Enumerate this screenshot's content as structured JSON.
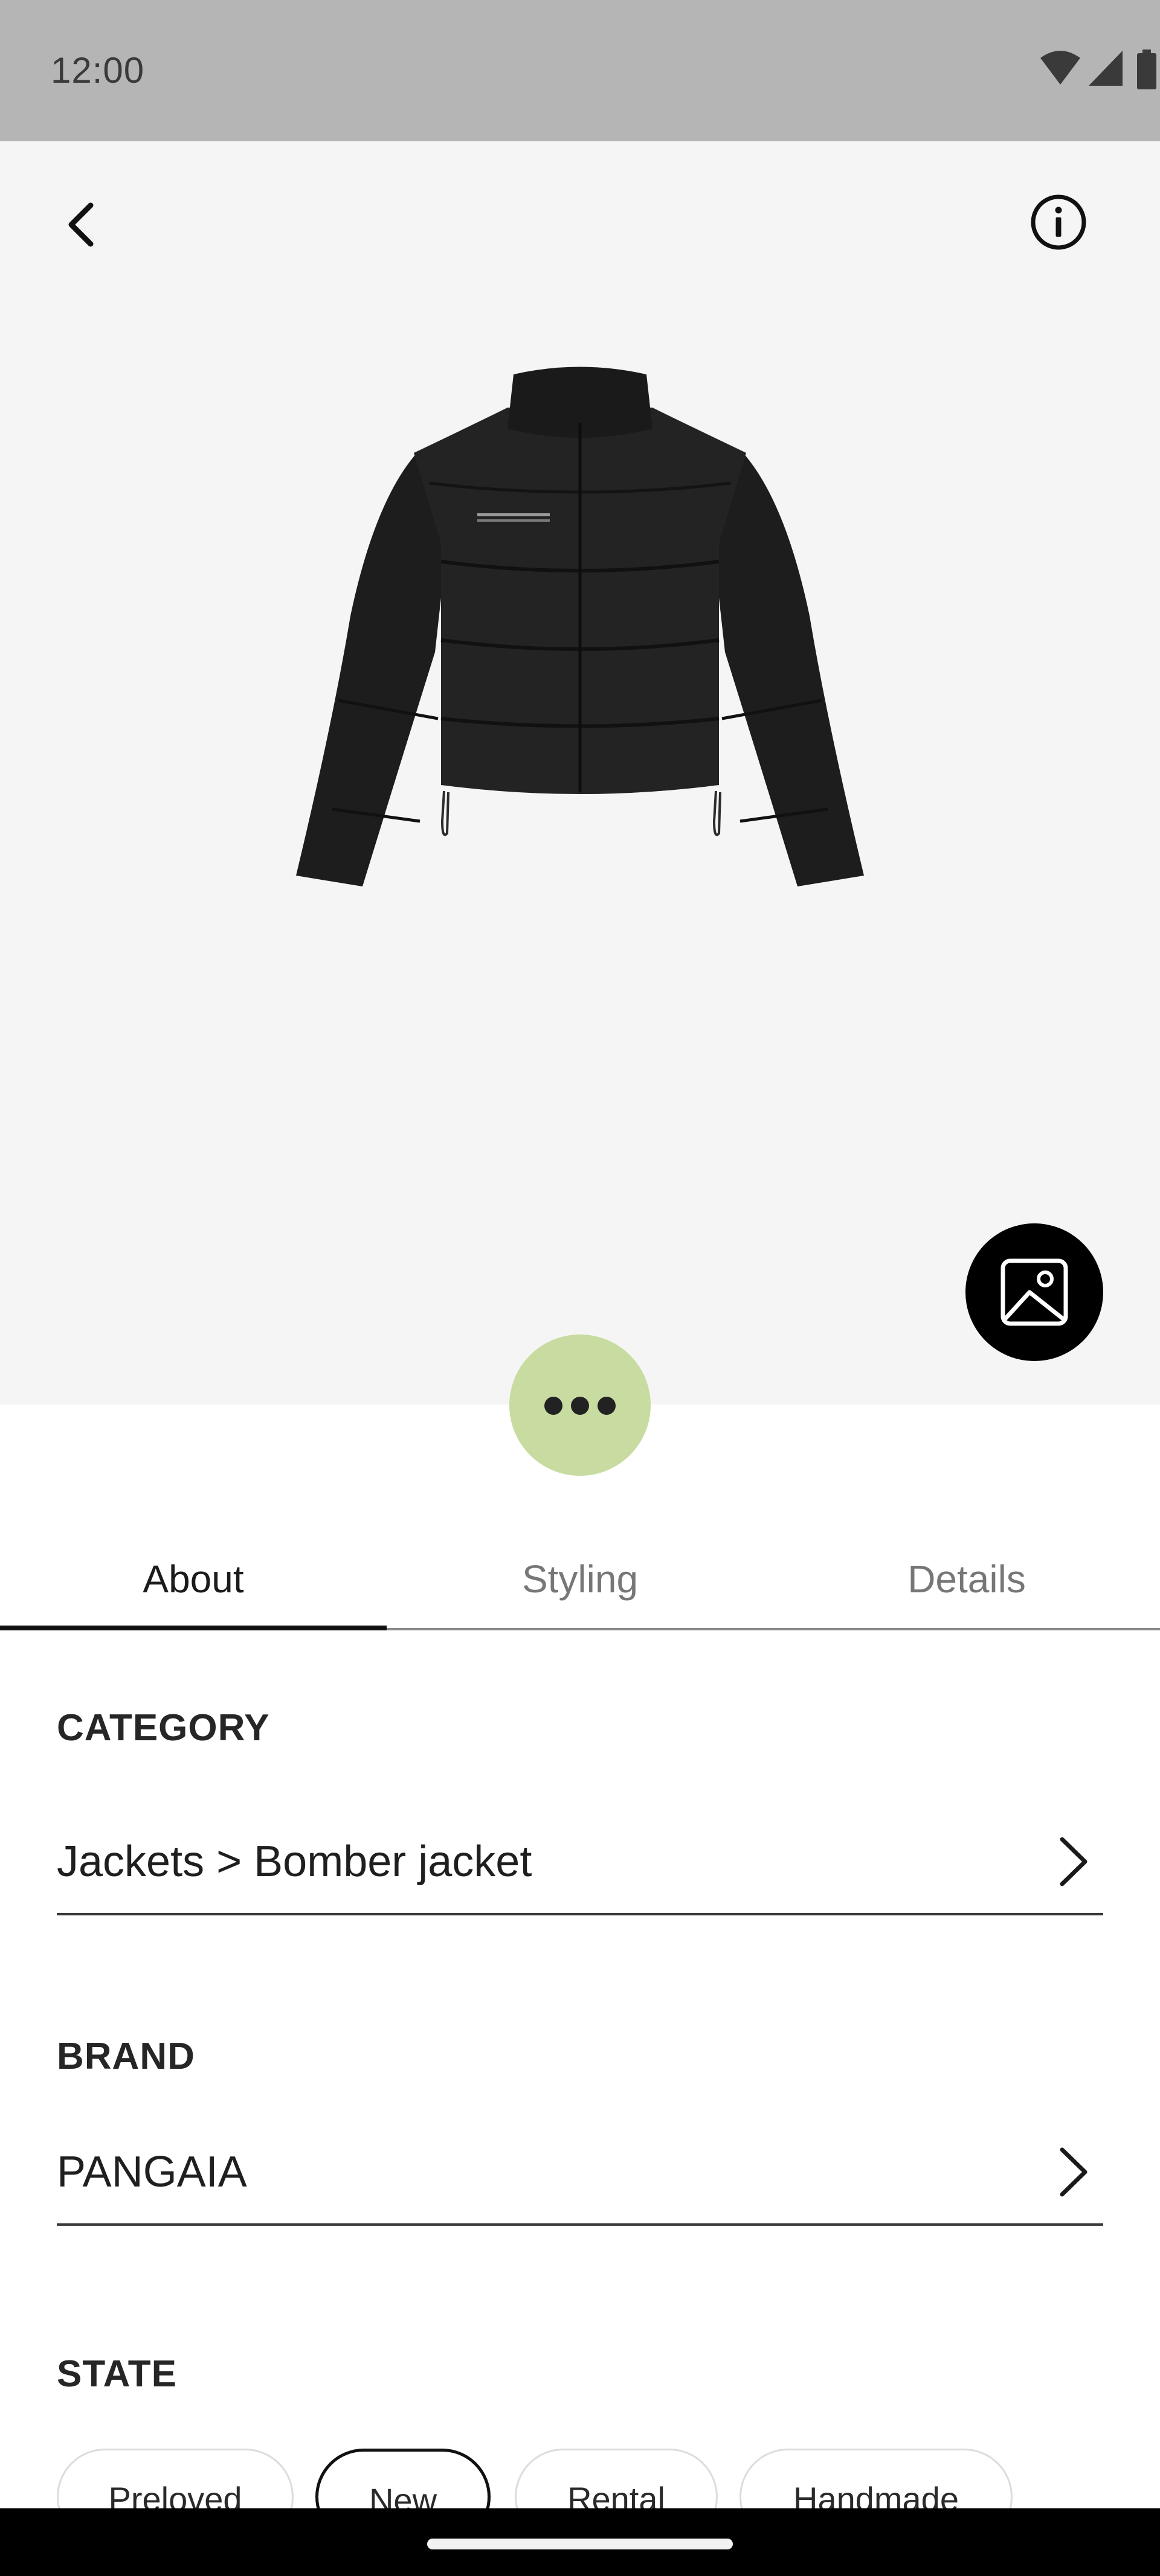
{
  "status_bar": {
    "time": "12:00",
    "icons": [
      "wifi-icon",
      "cellular-signal-icon",
      "battery-icon"
    ]
  },
  "hero": {
    "back_icon": "chevron-left-icon",
    "info_icon": "info-icon",
    "gallery_icon": "image-gallery-icon",
    "more_icon": "more-horizontal-icon",
    "more_button_color": "#c8dba0",
    "background": "#f5f5f5"
  },
  "tabs": [
    {
      "label": "About",
      "active": true
    },
    {
      "label": "Styling",
      "active": false
    },
    {
      "label": "Details",
      "active": false
    }
  ],
  "category": {
    "label": "CATEGORY",
    "value": "Jackets > Bomber jacket"
  },
  "brand": {
    "label": "BRAND",
    "value": "PANGAIA"
  },
  "state": {
    "label": "STATE",
    "options": [
      {
        "label": "Preloved",
        "selected": false
      },
      {
        "label": "New",
        "selected": true
      },
      {
        "label": "Rental",
        "selected": false
      },
      {
        "label": "Handmade",
        "selected": false
      }
    ]
  }
}
